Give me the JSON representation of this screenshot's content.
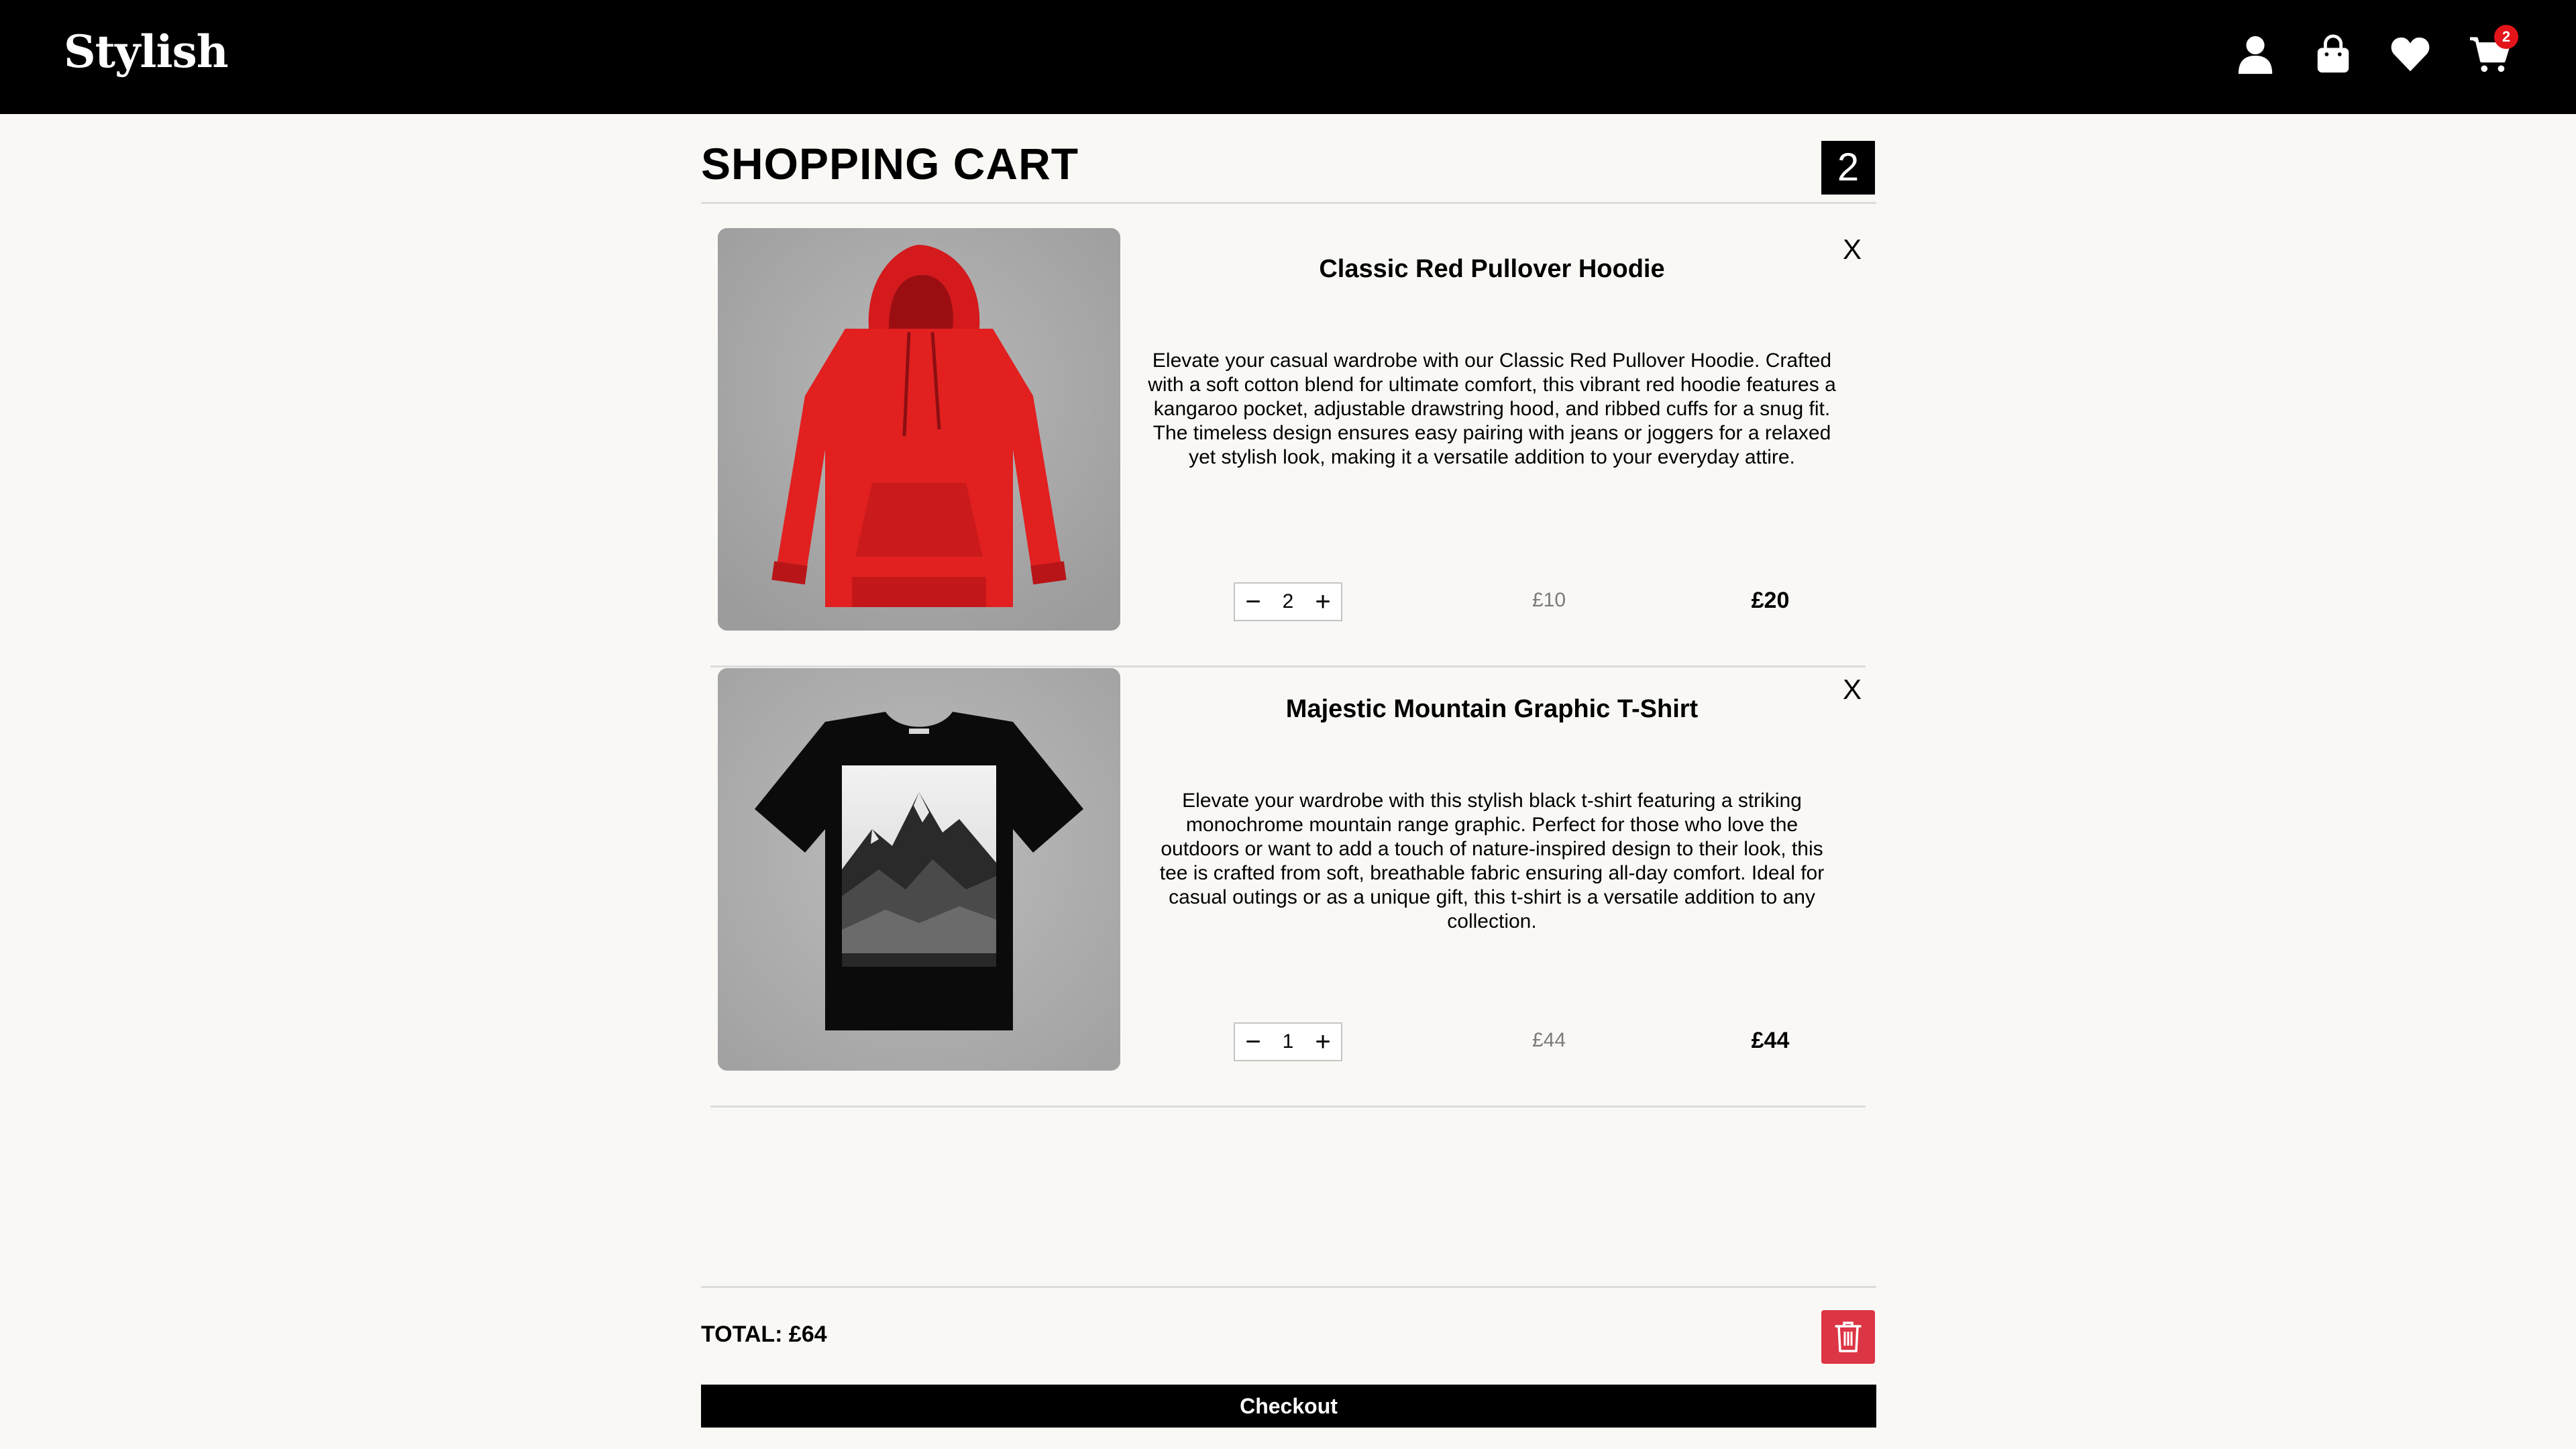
{
  "header": {
    "logo": "Stylish",
    "icons": [
      "user-icon",
      "shopping-bag-icon",
      "heart-icon",
      "cart-icon"
    ],
    "cart_badge": "2"
  },
  "cart": {
    "title": "SHOPPING CART",
    "count": "2",
    "items": [
      {
        "name": "Classic Red Pullover Hoodie",
        "description": "Elevate your casual wardrobe with our Classic Red Pullover Hoodie. Crafted with a soft cotton blend for ultimate comfort, this vibrant red hoodie features a kangaroo pocket, adjustable drawstring hood, and ribbed cuffs for a snug fit. The timeless design ensures easy pairing with jeans or joggers for a relaxed yet stylish look, making it a versatile addition to your everyday attire.",
        "quantity": "2",
        "unit_price": "£10",
        "line_total": "£20",
        "remove_label": "X",
        "decrement_label": "−",
        "increment_label": "+"
      },
      {
        "name": "Majestic Mountain Graphic T-Shirt",
        "description": "Elevate your wardrobe with this stylish black t-shirt featuring a striking monochrome mountain range graphic. Perfect for those who love the outdoors or want to add a touch of nature-inspired design to their look, this tee is crafted from soft, breathable fabric ensuring all-day comfort. Ideal for casual outings or as a unique gift, this t-shirt is a versatile addition to any collection.",
        "quantity": "1",
        "unit_price": "£44",
        "line_total": "£44",
        "remove_label": "X",
        "decrement_label": "−",
        "increment_label": "+"
      }
    ],
    "total": "TOTAL: £64",
    "checkout_label": "Checkout"
  },
  "colors": {
    "header_bg": "#000000",
    "page_bg": "#f9f8f5",
    "badge": "#e4141b",
    "trash_button": "#dc3545"
  }
}
